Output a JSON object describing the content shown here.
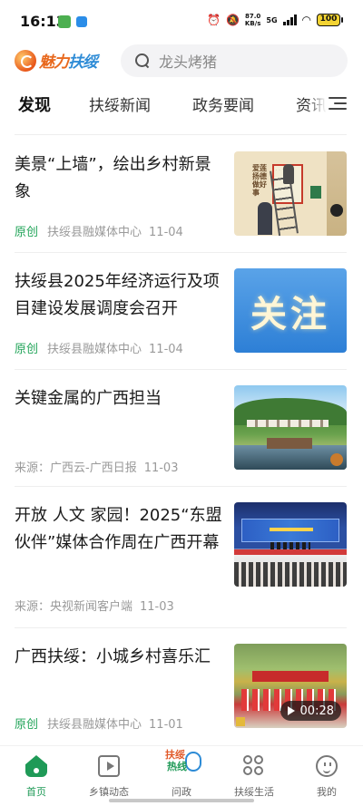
{
  "status_bar": {
    "time": "16:13",
    "net_speed_value": "87.0",
    "net_speed_unit": "KB/s",
    "signal_label": "5G",
    "battery": "100"
  },
  "header": {
    "logo_text_part1": "魅力",
    "logo_text_part2": "扶绥",
    "search_placeholder": "龙头烤猪"
  },
  "tabs": [
    {
      "label": "发现",
      "active": true
    },
    {
      "label": "扶绥新闻",
      "active": false
    },
    {
      "label": "政务要闻",
      "active": false
    },
    {
      "label": "资讯",
      "active": false
    }
  ],
  "feed": [
    {
      "title": "美景“上墙”，绘出乡村新景象",
      "tag": "原创",
      "source": "扶绥县融媒体中心",
      "date": "11-04",
      "thumb_text": [
        "爱莲",
        "扬德",
        "做好",
        "事"
      ],
      "frame_text": "人间有大爱"
    },
    {
      "title": "扶绥县2025年经济运行及项目建设发展调度会召开",
      "tag": "原创",
      "source": "扶绥县融媒体中心",
      "date": "11-04",
      "thumb_text": "关注"
    },
    {
      "title": "关键金属的广西担当",
      "tag": "",
      "source": "来源：广西云-广西日报",
      "date": "11-03"
    },
    {
      "title": "开放 人文 家园！2025“东盟伙伴”媒体合作周在广西开幕",
      "tag": "",
      "source": "来源：央视新闻客户端",
      "date": "11-03"
    },
    {
      "title": "广西扶绥：小城乡村喜乐汇",
      "tag": "原创",
      "source": "扶绥县融媒体中心",
      "date": "11-01",
      "video_duration": "00:28"
    }
  ],
  "bottom_nav": [
    {
      "label": "首页",
      "icon": "home-icon",
      "active": true
    },
    {
      "label": "乡镇动态",
      "icon": "play-box-icon",
      "active": false
    },
    {
      "label": "问政",
      "icon": "hotline-logo-icon",
      "active": false,
      "logo_line1": "扶绥",
      "logo_line2": "热线"
    },
    {
      "label": "扶绥生活",
      "icon": "four-circles-icon",
      "active": false
    },
    {
      "label": "我的",
      "icon": "smiley-icon",
      "active": false
    }
  ],
  "colors": {
    "accent_green": "#1f9a57",
    "original_tag": "#23a55a",
    "logo_orange": "#e8691e",
    "logo_blue": "#2d8bd6"
  }
}
